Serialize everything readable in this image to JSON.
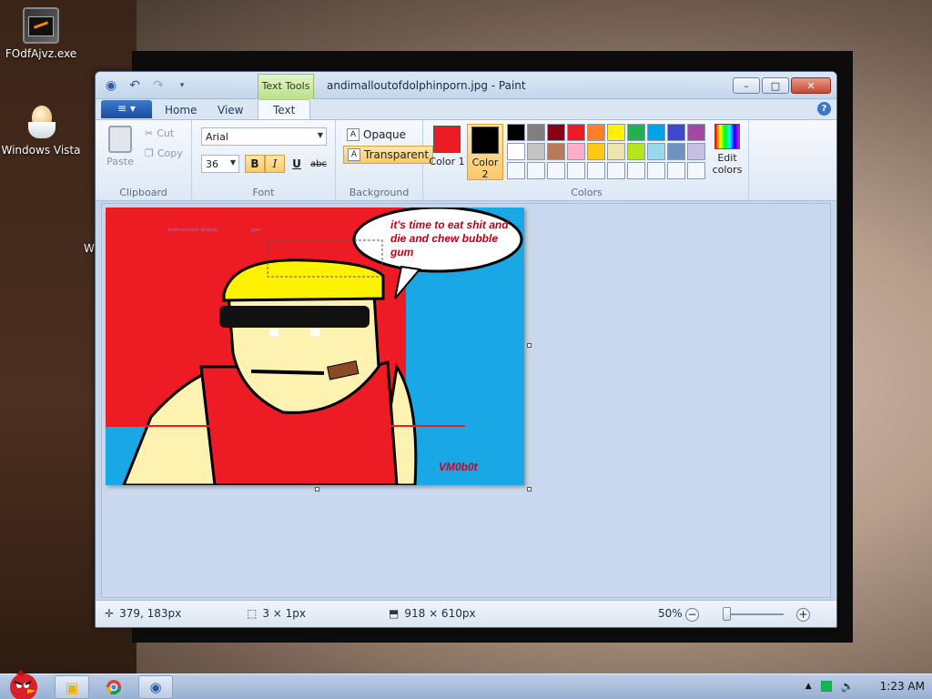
{
  "desktop": {
    "icons": [
      {
        "label": "FOdfAjvz.exe"
      },
      {
        "label": "Windows Vista"
      }
    ],
    "partial_text": "W"
  },
  "window": {
    "title": "andimalloutofdolphinporn.jpg - Paint",
    "context_tab": "Text Tools",
    "controls": {
      "minimize": "–",
      "maximize": "□",
      "close": "✕"
    }
  },
  "tabs": {
    "file": "≡ ▾",
    "home": "Home",
    "view": "View",
    "text": "Text",
    "help": "?"
  },
  "ribbon": {
    "clipboard": {
      "label": "Clipboard",
      "paste": "Paste",
      "cut": "Cut",
      "copy": "Copy"
    },
    "font": {
      "label": "Font",
      "family": "Arial",
      "size": "36",
      "bold": "B",
      "italic": "I",
      "underline": "U",
      "strikethrough": "abc"
    },
    "background": {
      "label": "Background",
      "opaque": "Opaque",
      "transparent": "Transparent"
    },
    "colors": {
      "label": "Colors",
      "color1_label": "Color 1",
      "color2_label": "Color 2",
      "color1": "#ed1c24",
      "color2": "#000000",
      "edit": "Edit colors",
      "palette_row1": [
        "#000000",
        "#7f7f7f",
        "#880015",
        "#ed1c24",
        "#ff7f27",
        "#fff200",
        "#22b14c",
        "#00a2e8",
        "#3f48cc",
        "#a349a4"
      ],
      "palette_row2": [
        "#ffffff",
        "#c3c3c3",
        "#b97a57",
        "#ffaec9",
        "#ffc90e",
        "#efe4b0",
        "#b5e61d",
        "#99d9ea",
        "#7092be",
        "#c8bfe7"
      ],
      "palette_row3": [
        "#ffffff",
        "#ffffff",
        "#ffffff",
        "#ffffff",
        "#ffffff",
        "#ffffff",
        "#ffffff",
        "#ffffff",
        "#ffffff",
        "#ffffff"
      ]
    }
  },
  "image": {
    "speech": "it's time to eat shit and die and chew bubble gum",
    "signature": "VM0b0t",
    "small_text_1": "andimalloutof dolphin",
    "small_text_2": "gum"
  },
  "status": {
    "cursor": "379, 183px",
    "selection": "3 × 1px",
    "image_size": "918 × 610px",
    "zoom": "50%",
    "zoom_level": 0.5
  },
  "taskbar": {
    "time": "1:23 AM"
  }
}
